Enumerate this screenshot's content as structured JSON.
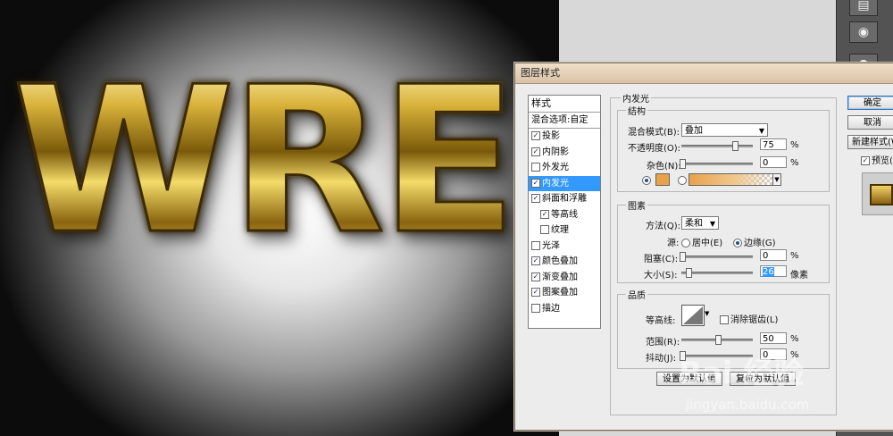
{
  "canvas": {
    "art_text": "WRE"
  },
  "dialog": {
    "title": "图层样式",
    "styles_list": {
      "header": "样式",
      "blend_options": "混合选项:自定",
      "items": [
        {
          "label": "投影",
          "checked": "✓"
        },
        {
          "label": "内阴影",
          "checked": "✓"
        },
        {
          "label": "外发光",
          "checked": ""
        },
        {
          "label": "内发光",
          "checked": "✓"
        },
        {
          "label": "斜面和浮雕",
          "checked": "✓"
        },
        {
          "label": "等高线",
          "checked": "✓"
        },
        {
          "label": "纹理",
          "checked": ""
        },
        {
          "label": "光泽",
          "checked": ""
        },
        {
          "label": "颜色叠加",
          "checked": "✓"
        },
        {
          "label": "渐变叠加",
          "checked": "✓"
        },
        {
          "label": "图案叠加",
          "checked": "✓"
        },
        {
          "label": "描边",
          "checked": ""
        }
      ]
    },
    "inner_glow": {
      "title": "内发光",
      "structure": {
        "title": "结构",
        "blend_mode_label": "混合模式(B):",
        "blend_mode_value": "叠加",
        "opacity_label": "不透明度(O):",
        "opacity_value": "75",
        "opacity_level": 0.75,
        "noise_label": "杂色(N):",
        "noise_value": "0",
        "unit": "%",
        "glow_color": "#e8a24a"
      },
      "elements": {
        "title": "图素",
        "method_label": "方法(Q):",
        "method_value": "柔和",
        "source_label": "源:",
        "source_center": "居中(E)",
        "source_edge": "边缘(G)",
        "choke_label": "阻塞(C):",
        "choke_value": "0",
        "size_label": "大小(S):",
        "size_value": "26",
        "size_unit": "像素",
        "size_level": 0.1
      },
      "quality": {
        "title": "品质",
        "contour_label": "等高线:",
        "anti_alias_label": "消除锯齿(L)",
        "range_label": "范围(R):",
        "range_value": "50",
        "jitter_label": "抖动(J):",
        "jitter_value": "0"
      },
      "set_default_label": "设置为默认值",
      "reset_default_label": "复位为默认值"
    },
    "buttons": {
      "ok": "确定",
      "cancel": "取消",
      "new_style": "新建样式(W)...",
      "preview": "预览(V)"
    }
  },
  "watermark": {
    "brand": "Bai 经验",
    "url": "jingyan.baidu.com"
  }
}
